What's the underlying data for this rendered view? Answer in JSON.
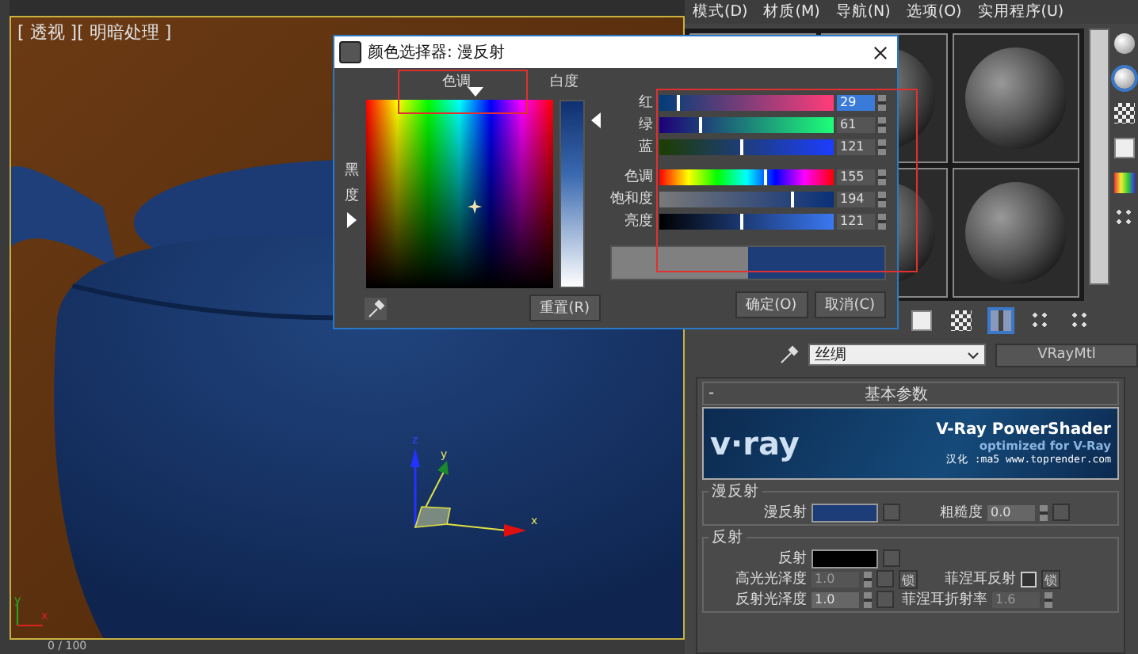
{
  "viewport": {
    "label": "[ 透视 ][ 明暗处理 ]",
    "gizmo_axes": [
      "x",
      "y",
      "z"
    ],
    "corner_axes": [
      "y",
      "x"
    ],
    "frame_counter": "0 / 100"
  },
  "menu": [
    "模式(D)",
    "材质(M)",
    "导航(N)",
    "选项(O)",
    "实用程序(U)"
  ],
  "material": {
    "name": "丝绸",
    "type": "VRayMtl"
  },
  "rollout": {
    "toggle": "-",
    "title": "基本参数"
  },
  "banner": {
    "logo": "v·ray",
    "title": "V-Ray PowerShader",
    "subtitle": "optimized for V-Ray",
    "credit": "汉化 :ma5 www.toprender.com"
  },
  "diffuse_group": {
    "title": "漫反射",
    "swatch_label": "漫反射",
    "color": "#1d3d79",
    "roughness_label": "粗糙度",
    "roughness": "0.0"
  },
  "reflect_group": {
    "title": "反射",
    "swatch_label": "反射",
    "color": "#000000",
    "hilight_label": "高光光泽度",
    "hilight": "1.0",
    "hilight_disabled": true,
    "lock": "锁",
    "fresnel_label": "菲涅耳反射",
    "fresnel_checked": false,
    "fresnel_lock": "锁",
    "gloss_label": "反射光泽度",
    "gloss": "1.0",
    "ior_label": "菲涅耳折射率",
    "ior": "1.6",
    "ior_disabled": true
  },
  "dialog": {
    "title": "颜色选择器: 漫反射",
    "hue_label": "色调",
    "white_label": "白度",
    "black_label": "黑度",
    "sliders": [
      {
        "kind": "red",
        "label": "红",
        "value": "29",
        "level": 0.11,
        "highlighted": true
      },
      {
        "kind": "green",
        "label": "绿",
        "value": "61",
        "level": 0.24,
        "highlighted": false
      },
      {
        "kind": "blue",
        "label": "蓝",
        "value": "121",
        "level": 0.47,
        "highlighted": false
      },
      {
        "kind": "hue",
        "label": "色调",
        "value": "155",
        "level": 0.61,
        "highlighted": false
      },
      {
        "kind": "saturation",
        "label": "饱和度",
        "value": "194",
        "level": 0.76,
        "highlighted": false
      },
      {
        "kind": "value",
        "label": "亮度",
        "value": "121",
        "level": 0.47,
        "highlighted": false
      }
    ],
    "preview": [
      {
        "color": "#808080"
      },
      {
        "color": "#1d3d79"
      }
    ],
    "buttons": {
      "reset": "重置(R)",
      "ok": "确定(O)",
      "cancel": "取消(C)"
    }
  }
}
